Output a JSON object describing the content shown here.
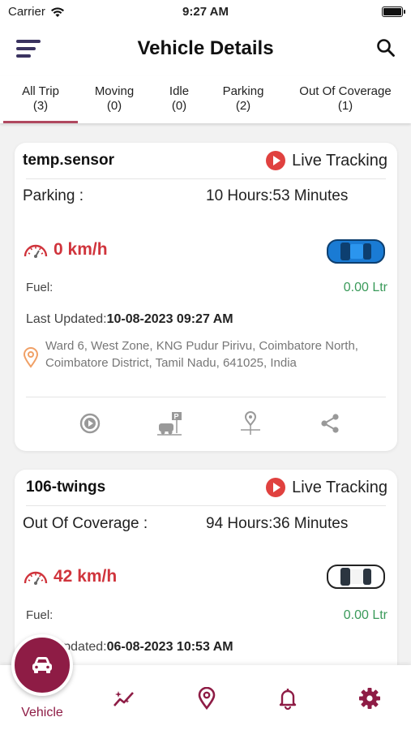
{
  "status_bar": {
    "carrier": "Carrier",
    "time": "9:27 AM"
  },
  "header": {
    "title": "Vehicle Details",
    "menu_icon": "hamburger-menu-icon",
    "search_icon": "search-icon"
  },
  "tabs": [
    {
      "label": "All Trip",
      "count": "(3)",
      "active": true
    },
    {
      "label": "Moving",
      "count": "(0)"
    },
    {
      "label": "Idle",
      "count": "(0)"
    },
    {
      "label": "Parking",
      "count": "(2)"
    },
    {
      "label": "Out Of Coverage",
      "count": "(1)"
    }
  ],
  "accent_color": "#8e1c45",
  "vehicles": [
    {
      "name": "temp.sensor",
      "live_label": "Live Tracking",
      "status": "Parking :",
      "duration": "10 Hours:53 Minutes",
      "speed": "0 km/h",
      "car_color": "blue",
      "fuel_label": "Fuel:",
      "fuel_value": "0.00 Ltr",
      "updated_label": "Last Updated:",
      "updated_value": "10-08-2023 09:27 AM",
      "address": "Ward 6, West Zone, KNG Pudur Pirivu, Coimbatore North, Coimbatore District, Tamil Nadu, 641025, India"
    },
    {
      "name": "106-twings",
      "live_label": "Live Tracking",
      "status": "Out Of Coverage :",
      "duration": "94 Hours:36 Minutes",
      "speed": "42 km/h",
      "car_color": "white",
      "fuel_label": "Fuel:",
      "fuel_value": "0.00 Ltr",
      "updated_label": "Last Updated:",
      "updated_value": "06-08-2023 10:53 AM"
    }
  ],
  "bottom_nav": {
    "active_label": "Vehicle",
    "items": [
      "car-icon",
      "analytics-icon",
      "location-pin-icon",
      "bell-icon",
      "gear-icon"
    ]
  }
}
